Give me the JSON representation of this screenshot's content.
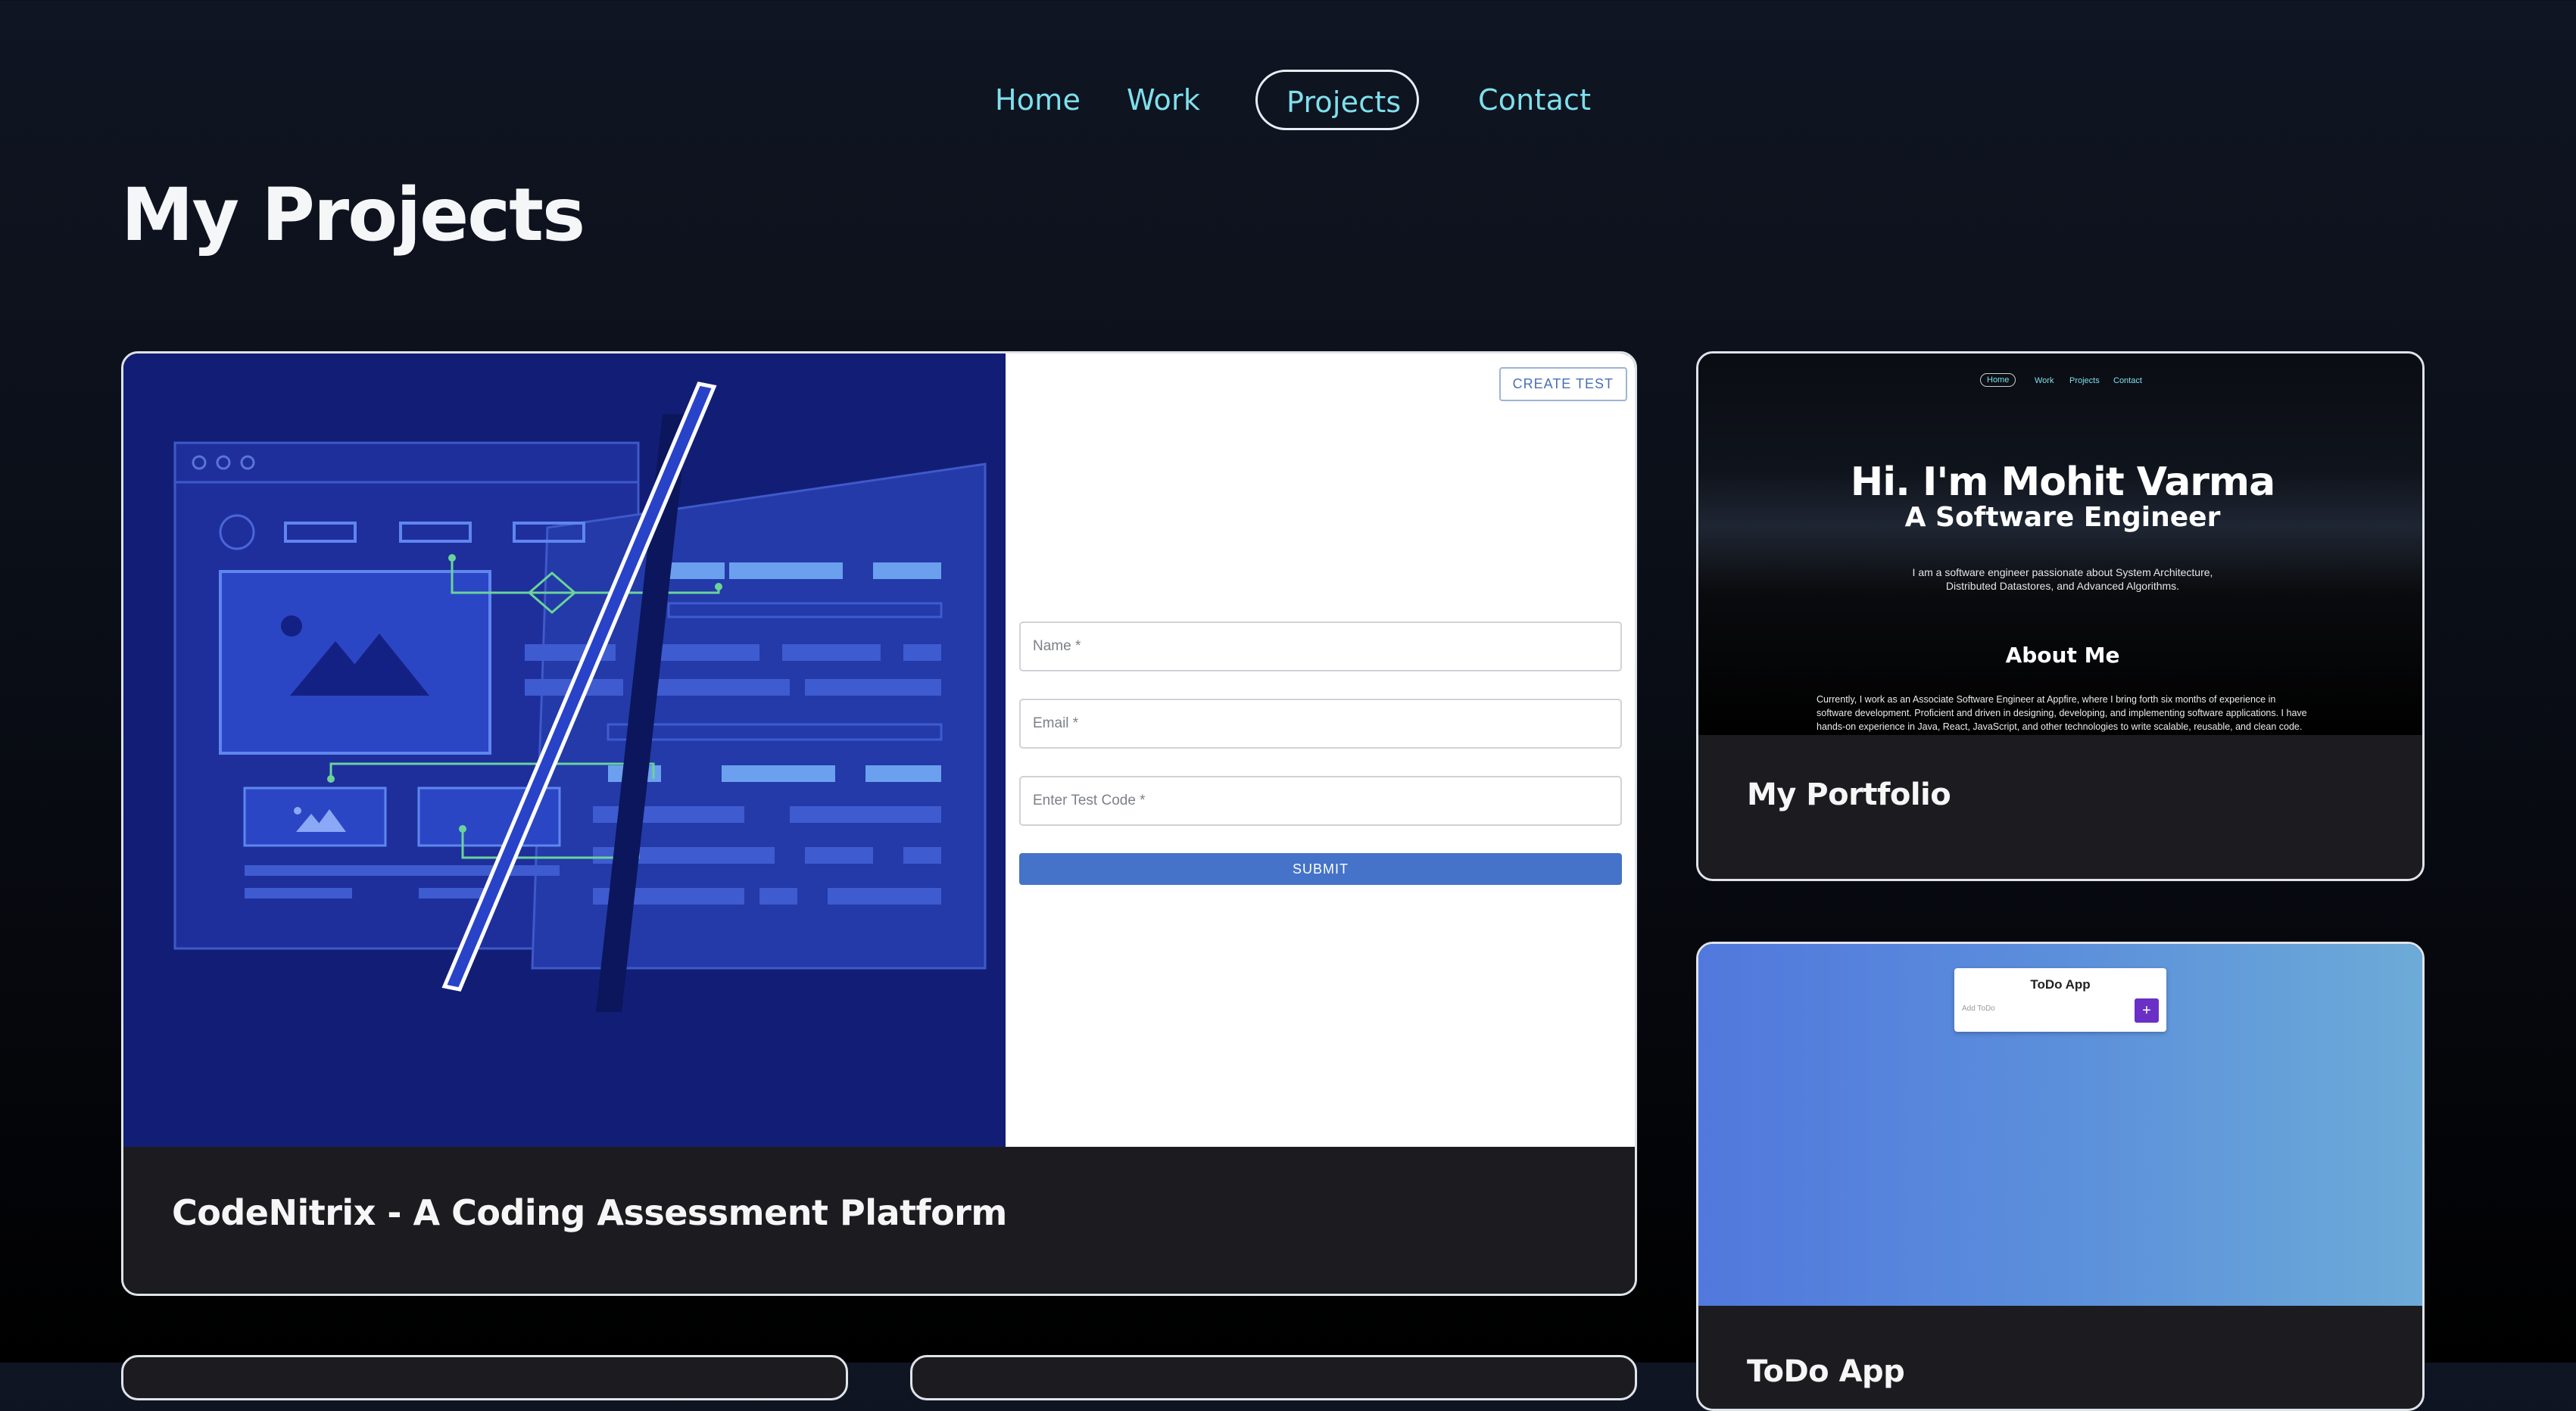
{
  "nav": {
    "items": [
      {
        "label": "Home"
      },
      {
        "label": "Work"
      },
      {
        "label": "Projects"
      },
      {
        "label": "Contact"
      }
    ],
    "active": "Projects"
  },
  "page": {
    "title": "My Projects"
  },
  "projects": [
    {
      "title": "CodeNitrix - A Coding Assessment Platform",
      "preview": {
        "create_test": "CREATE TEST",
        "name_placeholder": "Name *",
        "email_placeholder": "Email *",
        "code_placeholder": "Enter Test Code *",
        "submit": "SUBMIT"
      }
    },
    {
      "title": "My Portfolio",
      "preview": {
        "nav": [
          "Home",
          "Work",
          "Projects",
          "Contact"
        ],
        "headline": "Hi. I'm Mohit Varma",
        "subheadline": "A Software Engineer",
        "intro": "I am a software engineer passionate about System Architecture, Distributed Datastores, and Advanced Algorithms.",
        "about_title": "About Me",
        "about_body": "Currently, I work as an Associate Software Engineer at Appfire, where I bring forth six months of experience in software development. Proficient and driven in designing, developing, and implementing software applications. I have hands-on experience in Java, React, JavaScript, and other technologies to write scalable, reusable, and clean code. Additionally, I have"
      }
    },
    {
      "title": "ToDo App",
      "preview": {
        "app_title": "ToDo App",
        "input_placeholder": "Add ToDo",
        "add_button": "+"
      }
    }
  ],
  "colors": {
    "nav_link": "#7ee0ec",
    "card_footer": "#1c1c20",
    "codenitrix_bg": "#121e75",
    "submit_blue": "#4573c9"
  }
}
